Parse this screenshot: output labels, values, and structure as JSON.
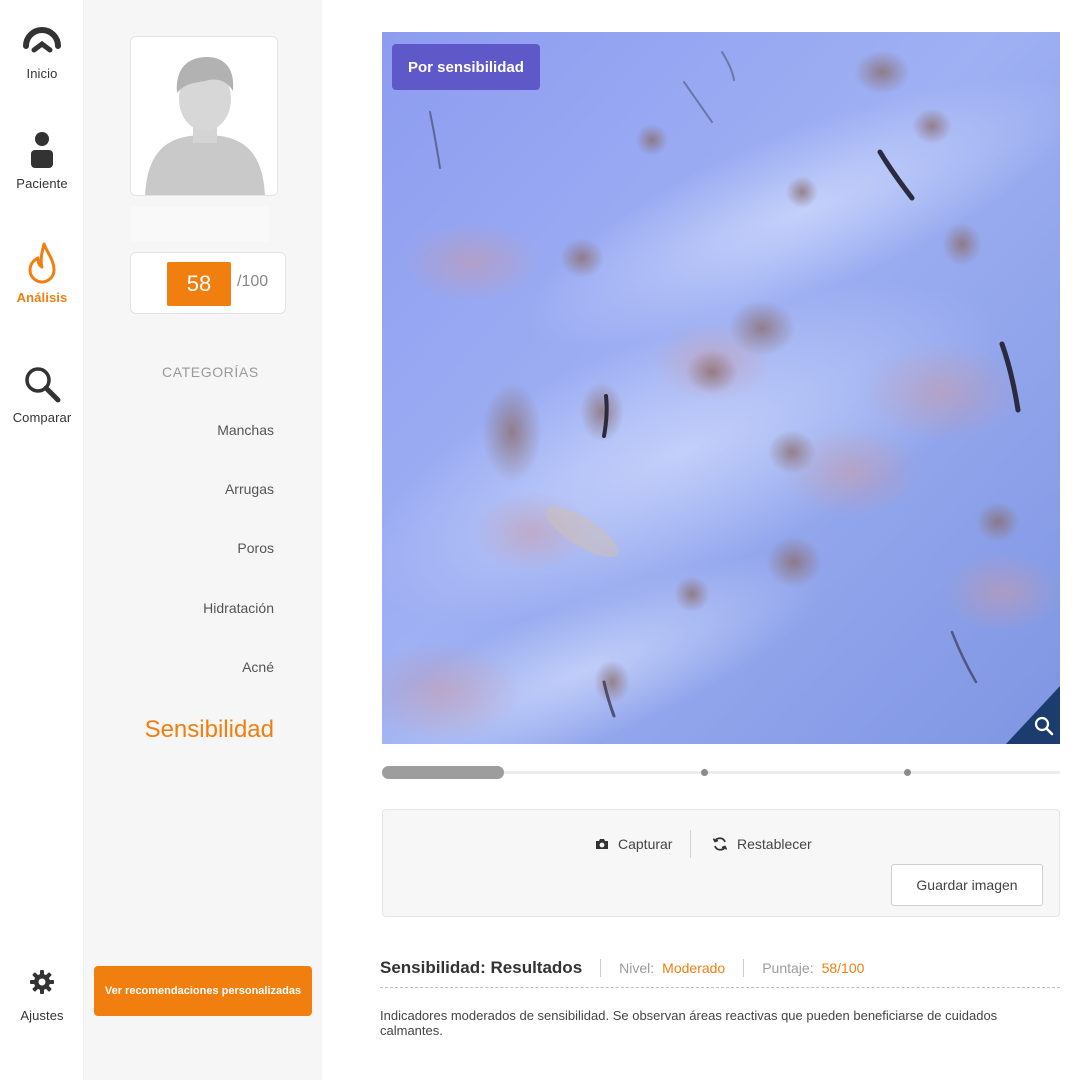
{
  "nav": {
    "items": [
      {
        "label": "Inicio",
        "icon": "home-arc-icon"
      },
      {
        "label": "Paciente",
        "icon": "user-icon"
      },
      {
        "label": "Análisis",
        "icon": "flame-icon"
      },
      {
        "label": "Comparar",
        "icon": "magnifier-icon"
      }
    ],
    "settings": {
      "label": "Ajustes",
      "icon": "gear-icon"
    }
  },
  "profile": {
    "score": "58",
    "score_max": "/100"
  },
  "categories": {
    "title": "CATEGORÍAS",
    "items": [
      "Manchas",
      "Arrugas",
      "Poros",
      "Hidratación",
      "Acné",
      "Sensibilidad"
    ],
    "active": "Sensibilidad"
  },
  "recommendations_button": "Ver recomendaciones personalizadas",
  "viewer": {
    "mode_label": "Por sensibilidad",
    "zoom_icon": "zoom-icon"
  },
  "slider": {
    "position_fraction": 0.18,
    "ticks": [
      0.475,
      0.775
    ]
  },
  "toolbar": {
    "capture_label": "Capturar",
    "reset_label": "Restablecer",
    "save_label": "Guardar imagen"
  },
  "results": {
    "title": "Sensibilidad: Resultados",
    "level_label": "Nivel:",
    "level_value": "Moderado",
    "score_label": "Puntaje:",
    "score_value": "58/100",
    "description": "Indicadores moderados de sensibilidad. Se observan áreas reactivas que pueden beneficiarse de cuidados calmantes."
  },
  "colors": {
    "accent": "#f07f10",
    "badge": "#5f58c8",
    "corner": "#1d3c6e"
  }
}
